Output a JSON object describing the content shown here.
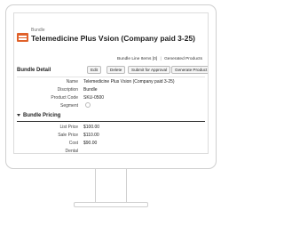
{
  "record": {
    "type_label": "Bundle",
    "title": "Telemedicine Plus Vsion (Company paid 3-25)"
  },
  "related_links": {
    "bundle_line_items": "Bundle Line Items [0]",
    "separator": "|",
    "generated_products": "Generated Products"
  },
  "detail": {
    "section_title": "Bundle Detail",
    "buttons": {
      "edit": "Edit",
      "delete": "Delete",
      "submit": "Submit for Approval",
      "generate": "Generate Product"
    },
    "fields": {
      "name_label": "Name",
      "name_value": "Telemedicine Plus Vsion (Company paid 3-25)",
      "description_label": "Discription",
      "description_value": "Bundle",
      "product_code_label": "Product Code",
      "product_code_value": "SKU-0500",
      "segment_label": "Segment"
    }
  },
  "pricing": {
    "section_title": "Bundle Pricing",
    "list_price_label": "List Price",
    "list_price_value": "$100.00",
    "sale_price_label": "Sale Price",
    "sale_price_value": "$110.00",
    "cost_label": "Cost",
    "cost_value": "$90.00",
    "dental_label": "Dental"
  },
  "colors": {
    "accent": "#e0612a",
    "frame": "#cfcfcf"
  },
  "icons": {
    "record": "bundle-icon",
    "section_toggle": "triangle-down-icon",
    "lookup": "lookup-icon"
  }
}
